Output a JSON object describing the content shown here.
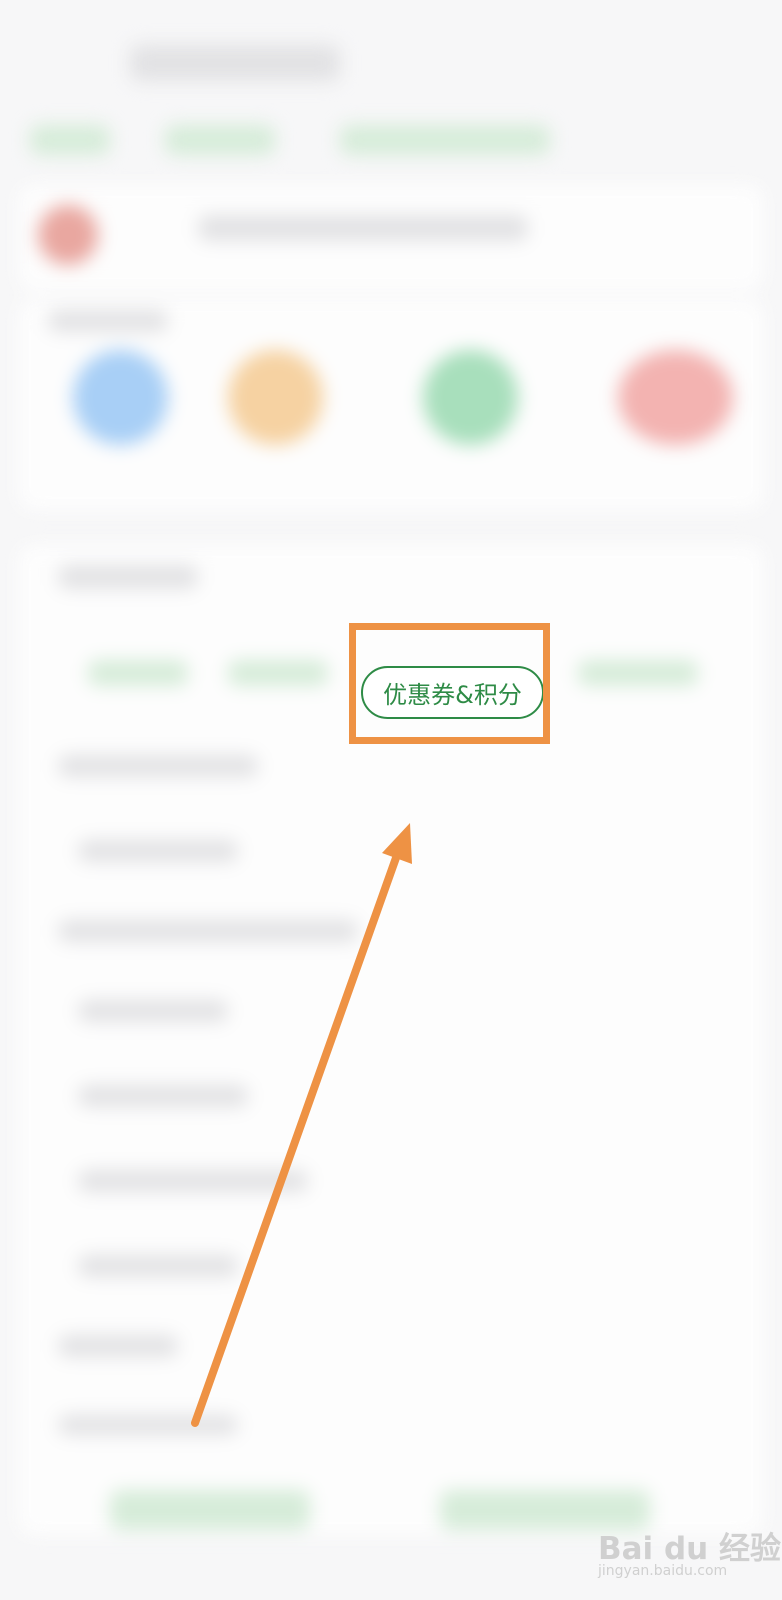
{
  "highlighted_button": {
    "label": "优惠券&积分"
  },
  "colors": {
    "accent_green": "#2e8b46",
    "annotation_orange": "#ee9244"
  },
  "icons": [
    "blurred-service-icon-blue",
    "blurred-service-icon-orange",
    "blurred-service-icon-green",
    "blurred-service-icon-red"
  ],
  "watermark": {
    "main": "Bai du 经验",
    "sub": "jingyan.baidu.com"
  }
}
